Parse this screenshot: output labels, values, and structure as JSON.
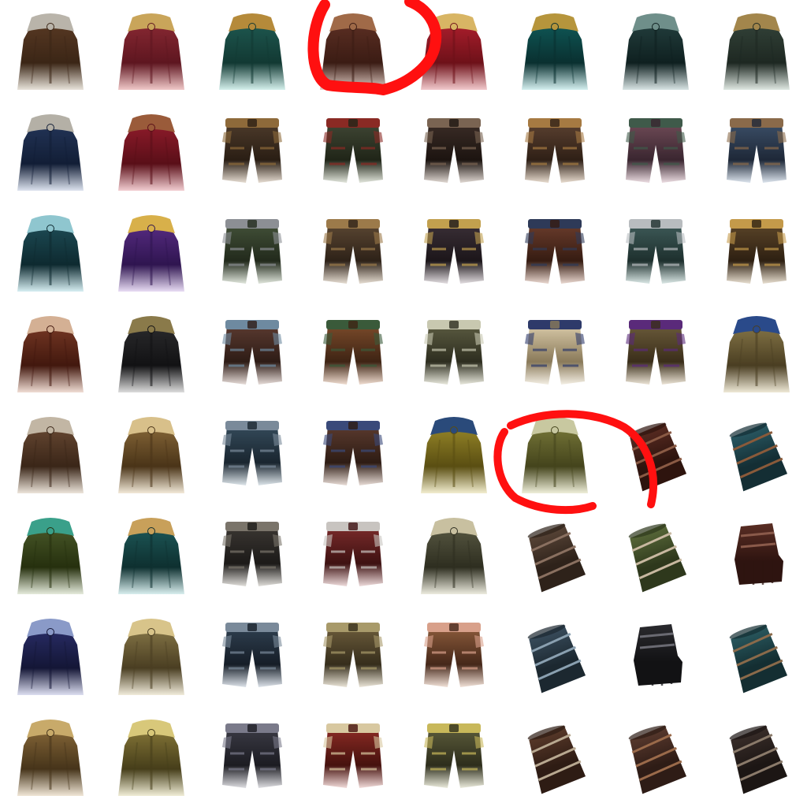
{
  "sheet": {
    "background": "#ffffff",
    "rows": 8,
    "columns": 8,
    "items": [
      {
        "type": "cloak",
        "name": "fur-collar-cloak-icon",
        "colors": [
          "#5a3a24",
          "#3b2616",
          "#b9b4aa",
          "#e8e3da"
        ]
      },
      {
        "type": "cloak",
        "name": "crimson-cloak-icon",
        "colors": [
          "#8c2a34",
          "#5e1620",
          "#c9a55a",
          "#f0c8c8"
        ]
      },
      {
        "type": "cloak",
        "name": "teal-cloak-icon",
        "colors": [
          "#1f5a52",
          "#123933",
          "#b58a3a",
          "#d4f0ec"
        ]
      },
      {
        "type": "cloak",
        "name": "brown-leather-cloak-icon",
        "colors": [
          "#5e3024",
          "#3b1c14",
          "#a06a48",
          "#e4d0c8"
        ]
      },
      {
        "type": "cloak",
        "name": "red-ornate-cloak-icon",
        "colors": [
          "#b11f2e",
          "#6e1119",
          "#d8b564",
          "#f2c9cc"
        ]
      },
      {
        "type": "cloak",
        "name": "teal-gold-cloak-icon",
        "colors": [
          "#0f5b5a",
          "#0a3030",
          "#b6953c",
          "#d4f0f0"
        ]
      },
      {
        "type": "cloak",
        "name": "feathered-dark-cloak-icon",
        "colors": [
          "#24403f",
          "#0f2020",
          "#6f8f8a",
          "#d8e4e4"
        ]
      },
      {
        "type": "cloak",
        "name": "patterned-green-cloak-icon",
        "colors": [
          "#34443a",
          "#1e2822",
          "#a3864c",
          "#dfe8e2"
        ]
      },
      {
        "type": "cloak",
        "name": "blue-fur-cloak-icon",
        "colors": [
          "#24365a",
          "#121e36",
          "#b4b0a6",
          "#dde3ef"
        ]
      },
      {
        "type": "cloak",
        "name": "crimson-shoulder-cloak-icon",
        "colors": [
          "#931c2c",
          "#5a0f18",
          "#9a5b3a",
          "#f2cdd1"
        ]
      },
      {
        "type": "pants",
        "name": "leather-belted-pants-icon",
        "colors": [
          "#4c3a2a",
          "#2a1e14",
          "#8e6a3a",
          "#e6ddd2"
        ]
      },
      {
        "type": "pants",
        "name": "green-red-pants-icon",
        "colors": [
          "#3f4634",
          "#202518",
          "#8a2a24",
          "#e2e6dc"
        ]
      },
      {
        "type": "pants",
        "name": "dark-leather-pants-icon",
        "colors": [
          "#3a2c26",
          "#1c1410",
          "#7a6452",
          "#e0d8d2"
        ]
      },
      {
        "type": "pants",
        "name": "strapped-leather-pants-icon",
        "colors": [
          "#5a4030",
          "#2f2016",
          "#a67a42",
          "#e8dccf"
        ]
      },
      {
        "type": "pants",
        "name": "mauve-armored-pants-icon",
        "colors": [
          "#6e4a56",
          "#3a2630",
          "#3f5a4a",
          "#ecdde2"
        ]
      },
      {
        "type": "pants",
        "name": "blue-armored-pants-icon",
        "colors": [
          "#3b4e66",
          "#1e2838",
          "#8a6a4a",
          "#dde5ee"
        ]
      },
      {
        "type": "cloak",
        "name": "knot-teal-cloak-icon",
        "colors": [
          "#1e4e58",
          "#0e2a30",
          "#8fc6cf",
          "#d6eef2"
        ]
      },
      {
        "type": "cloak",
        "name": "violet-gold-winged-cloak-icon",
        "colors": [
          "#5a2d86",
          "#2f1550",
          "#d8b04a",
          "#e8dcf4"
        ]
      },
      {
        "type": "pants",
        "name": "green-plated-pants-icon",
        "colors": [
          "#425038",
          "#222a1c",
          "#8c8f94",
          "#e0e6dc"
        ]
      },
      {
        "type": "pants",
        "name": "bronze-plated-pants-icon",
        "colors": [
          "#5a4632",
          "#2e2218",
          "#9c7a4a",
          "#e6ddd2"
        ]
      },
      {
        "type": "pants",
        "name": "navy-belt-pants-icon",
        "colors": [
          "#3a2f36",
          "#1c161a",
          "#c2a04e",
          "#e2dde0"
        ]
      },
      {
        "type": "pants",
        "name": "rust-strapped-pants-icon",
        "colors": [
          "#6a3c2c",
          "#361c12",
          "#2e3a58",
          "#ead8d0"
        ]
      },
      {
        "type": "pants",
        "name": "silver-teal-pants-icon",
        "colors": [
          "#3e5a58",
          "#1e302e",
          "#b8bcbf",
          "#dbe8e6"
        ]
      },
      {
        "type": "pants",
        "name": "gold-trim-pants-icon",
        "colors": [
          "#5a4428",
          "#2e2012",
          "#c49a4a",
          "#e8dfd0"
        ]
      },
      {
        "type": "cloak",
        "name": "rust-knot-cloak-icon",
        "colors": [
          "#7a3a26",
          "#42180e",
          "#d4b094",
          "#f0ddd4"
        ]
      },
      {
        "type": "cloak",
        "name": "dark-spiked-cloak-icon",
        "colors": [
          "#2c2c2e",
          "#121214",
          "#8a7a4a",
          "#dcdcdc"
        ]
      },
      {
        "type": "pants",
        "name": "blue-steel-pants-icon",
        "colors": [
          "#5a3a30",
          "#2e1c16",
          "#6e8aa0",
          "#e6dcd8"
        ]
      },
      {
        "type": "pants",
        "name": "copper-plated-pants-icon",
        "colors": [
          "#7a4a2a",
          "#3e2414",
          "#3a5a3a",
          "#f0ddd0"
        ]
      },
      {
        "type": "pants",
        "name": "gilded-plate-pants-icon",
        "colors": [
          "#5a5a40",
          "#2e2e20",
          "#c8c8b0",
          "#e8e8dc"
        ]
      },
      {
        "type": "pants",
        "name": "bone-plate-pants-icon",
        "colors": [
          "#d8c9a8",
          "#8a7a5a",
          "#2e3a6a",
          "#f4efe4"
        ]
      },
      {
        "type": "pants",
        "name": "violet-gilded-pants-icon",
        "colors": [
          "#6a5a3a",
          "#3a2e1a",
          "#5a2a7a",
          "#ece4d6"
        ]
      },
      {
        "type": "cloak",
        "name": "gold-blue-crest-cloak-icon",
        "colors": [
          "#8a7a4a",
          "#4a3e22",
          "#2a4a8a",
          "#eee8d6"
        ]
      },
      {
        "type": "cloak",
        "name": "fur-hooded-mantle-icon",
        "colors": [
          "#6a4a34",
          "#3a2618",
          "#c2b6a4",
          "#ece4da"
        ]
      },
      {
        "type": "cloak",
        "name": "gold-embroidered-robe-icon",
        "colors": [
          "#8a6a3a",
          "#4a3418",
          "#d8c08a",
          "#f2e9d8"
        ]
      },
      {
        "type": "pants",
        "name": "slate-belted-pants-icon",
        "colors": [
          "#344a5a",
          "#1a2630",
          "#7a8a9a",
          "#dde5ea"
        ]
      },
      {
        "type": "pants",
        "name": "sash-plated-pants-icon",
        "colors": [
          "#5a3a2e",
          "#2e1c14",
          "#3a4a7a",
          "#e8dcd6"
        ]
      },
      {
        "type": "cloak",
        "name": "golden-dragon-cloak-icon",
        "colors": [
          "#9a8a2a",
          "#5a4e12",
          "#2a4a7a",
          "#f2edcf"
        ]
      },
      {
        "type": "cloak",
        "name": "olive-spiked-cloak-icon",
        "colors": [
          "#7a7a3a",
          "#44441c",
          "#c8c8a0",
          "#eeeed9"
        ]
      },
      {
        "type": "bracer",
        "name": "leather-bracer-icon",
        "colors": [
          "#5a2c22",
          "#2e140e",
          "#8a5a44",
          "#f0dcd6"
        ]
      },
      {
        "type": "bracer",
        "name": "teal-bracer-icon",
        "colors": [
          "#2a5a64",
          "#142e34",
          "#8a5a3a",
          "#dceef0"
        ]
      },
      {
        "type": "cloak",
        "name": "olive-hood-cloak-icon",
        "colors": [
          "#4a5a2a",
          "#26300e",
          "#3aa08a",
          "#e4eadb"
        ]
      },
      {
        "type": "cloak",
        "name": "teal-gold-mantle-icon",
        "colors": [
          "#1e5a5a",
          "#0e3030",
          "#c8a05a",
          "#d8eeee"
        ]
      },
      {
        "type": "pants",
        "name": "black-plated-pants-icon",
        "colors": [
          "#3a3632",
          "#1c1a18",
          "#7a746a",
          "#e0deda"
        ]
      },
      {
        "type": "pants",
        "name": "red-silver-pants-icon",
        "colors": [
          "#7a2a2a",
          "#3e1212",
          "#c8c4c0",
          "#eedcdc"
        ]
      },
      {
        "type": "cloak",
        "name": "skull-plate-mantle-icon",
        "colors": [
          "#5a5a44",
          "#2e2e20",
          "#c8c0a0",
          "#ecebde"
        ]
      },
      {
        "type": "bracer",
        "name": "wrapped-bracer-icon",
        "colors": [
          "#5a4638",
          "#2e221a",
          "#8a7060",
          "#e8e0da"
        ]
      },
      {
        "type": "bracer",
        "name": "olive-fur-bracer-icon",
        "colors": [
          "#5a6a3a",
          "#2e381c",
          "#c8b8a0",
          "#e4e8dc"
        ]
      },
      {
        "type": "glove",
        "name": "brown-glove-icon",
        "colors": [
          "#5a2e24",
          "#2e1410",
          "#8a5a4a",
          "#f0dcd6"
        ]
      },
      {
        "type": "cloak",
        "name": "blue-sigil-cloak-icon",
        "colors": [
          "#2a2e6a",
          "#141636",
          "#8a9ac8",
          "#dcdef0"
        ]
      },
      {
        "type": "cloak",
        "name": "gold-feathered-robe-icon",
        "colors": [
          "#8a7a4a",
          "#4a3e22",
          "#d8c48a",
          "#f0ebda"
        ]
      },
      {
        "type": "pants",
        "name": "steel-blue-pants-icon",
        "colors": [
          "#2e3e4e",
          "#161e28",
          "#7a8a9a",
          "#dde3ea"
        ]
      },
      {
        "type": "pants",
        "name": "bronze-scale-pants-icon",
        "colors": [
          "#6a5a3a",
          "#362e1c",
          "#a89a6a",
          "#ebe5d8"
        ]
      },
      {
        "type": "pants",
        "name": "copper-ornate-pants-icon",
        "colors": [
          "#8a5a3a",
          "#46281a",
          "#d8a08a",
          "#f2e2d8"
        ]
      },
      {
        "type": "bracer",
        "name": "slate-bracer-icon",
        "colors": [
          "#3a4e5e",
          "#1c2830",
          "#8aa0b0",
          "#dde6ec"
        ]
      },
      {
        "type": "glove",
        "name": "black-plated-glove-icon",
        "colors": [
          "#2a2a2e",
          "#121214",
          "#6a6a72",
          "#dadadc"
        ]
      },
      {
        "type": "bracer",
        "name": "teal-studded-bracer-icon",
        "colors": [
          "#2a5a60",
          "#142e32",
          "#8a6a4a",
          "#dcecee"
        ]
      },
      {
        "type": "cloak",
        "name": "ochre-hooded-cloak-icon",
        "colors": [
          "#8a6a3a",
          "#46341a",
          "#c8aa6a",
          "#f0e6d6"
        ]
      },
      {
        "type": "cloak",
        "name": "gold-winged-mantle-icon",
        "colors": [
          "#8a7a3a",
          "#463e1a",
          "#d8c87a",
          "#f0edd6"
        ]
      },
      {
        "type": "pants",
        "name": "gunmetal-pants-icon",
        "colors": [
          "#3a3a44",
          "#1c1c22",
          "#7a7a8a",
          "#dedee2"
        ]
      },
      {
        "type": "pants",
        "name": "red-gold-pants-icon",
        "colors": [
          "#8a2a24",
          "#46120e",
          "#d8c8a0",
          "#f2dcda"
        ]
      },
      {
        "type": "pants",
        "name": "horned-gold-pants-icon",
        "colors": [
          "#5a5a3a",
          "#2e2e1c",
          "#c8b85a",
          "#ebebdc"
        ]
      },
      {
        "type": "bracer",
        "name": "fur-leather-bracer-icon",
        "colors": [
          "#5a3a2a",
          "#2e1c14",
          "#b8a890",
          "#ecdcd4"
        ]
      },
      {
        "type": "bracer",
        "name": "roped-bracer-icon",
        "colors": [
          "#5a3a2e",
          "#2e1c16",
          "#9a6a4a",
          "#ece0d8"
        ]
      },
      {
        "type": "bracer",
        "name": "engraved-bracer-icon",
        "colors": [
          "#3a2e2a",
          "#1c1614",
          "#8a7a6a",
          "#e6e0dc"
        ]
      }
    ]
  },
  "annotations": {
    "color": "#ff1010",
    "marks": [
      {
        "name": "red-circle-mark-top",
        "shape": "open-loop"
      },
      {
        "name": "red-circle-mark-middle",
        "shape": "open-loop"
      }
    ]
  }
}
